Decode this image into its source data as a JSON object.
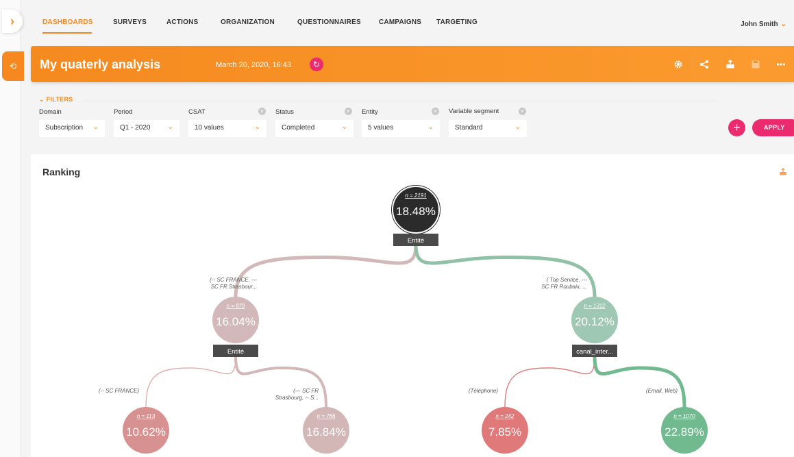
{
  "colors": {
    "accent": "#f7881f",
    "pink": "#ec2a6e"
  },
  "nav": {
    "items": [
      "DASHBOARDS",
      "SURVEYS",
      "ACTIONS",
      "ORGANIZATION",
      "QUESTIONNAIRES",
      "CAMPAIGNS",
      "TARGETING"
    ],
    "active": "DASHBOARDS",
    "user": "John Smith"
  },
  "header": {
    "title": "My quaterly analysis",
    "date": "March 20, 2020, 16:43",
    "icons": [
      "gear-icon",
      "share-icon",
      "export-icon",
      "save-icon",
      "more-icon"
    ]
  },
  "filters": {
    "label": "FILTERS",
    "items": [
      {
        "label": "Domain",
        "value": "Subscription",
        "clearable": false
      },
      {
        "label": "Period",
        "value": "Q1 - 2020",
        "clearable": false
      },
      {
        "label": "CSAT",
        "value": "10 values",
        "clearable": true
      },
      {
        "label": "Status",
        "value": "Completed",
        "clearable": true
      },
      {
        "label": "Entity",
        "value": "5 values",
        "clearable": true
      },
      {
        "label": "Variable segment",
        "value": "Standard",
        "clearable": true
      }
    ],
    "apply_label": "APPLY"
  },
  "ranking": {
    "title": "Ranking",
    "nodes": [
      {
        "id": "root",
        "n": "n = 2191",
        "pct": "18.48%",
        "split": "Entité",
        "color": "#2b2b2b"
      },
      {
        "id": "left",
        "n": "n = 879",
        "pct": "16.04%",
        "split": "Entité",
        "color": "#d2b8b8",
        "edge": [
          "(-- SC FRANCE, ---",
          "SC FR Strasbour..."
        ]
      },
      {
        "id": "right",
        "n": "n = 1312",
        "pct": "20.12%",
        "split": "canal_inter...",
        "color": "#9ec8b3",
        "edge": [
          "( Top Service, ---",
          "SC FR Roubaix, ..."
        ]
      },
      {
        "id": "ll",
        "n": "n = 113",
        "pct": "10.62%",
        "color": "#d89191",
        "edge": [
          "(-- SC FRANCE)"
        ]
      },
      {
        "id": "lr",
        "n": "n = 766",
        "pct": "16.84%",
        "color": "#d3b6b6",
        "edge": [
          "(--- SC FR",
          "Strasbourg, -- S..."
        ]
      },
      {
        "id": "rl",
        "n": "n = 242",
        "pct": "7.85%",
        "color": "#e07a7a",
        "edge": [
          "(Téléphone)"
        ]
      },
      {
        "id": "rr",
        "n": "n = 1070",
        "pct": "22.89%",
        "color": "#71b98f",
        "edge": [
          "(Email, Web)"
        ]
      }
    ]
  }
}
